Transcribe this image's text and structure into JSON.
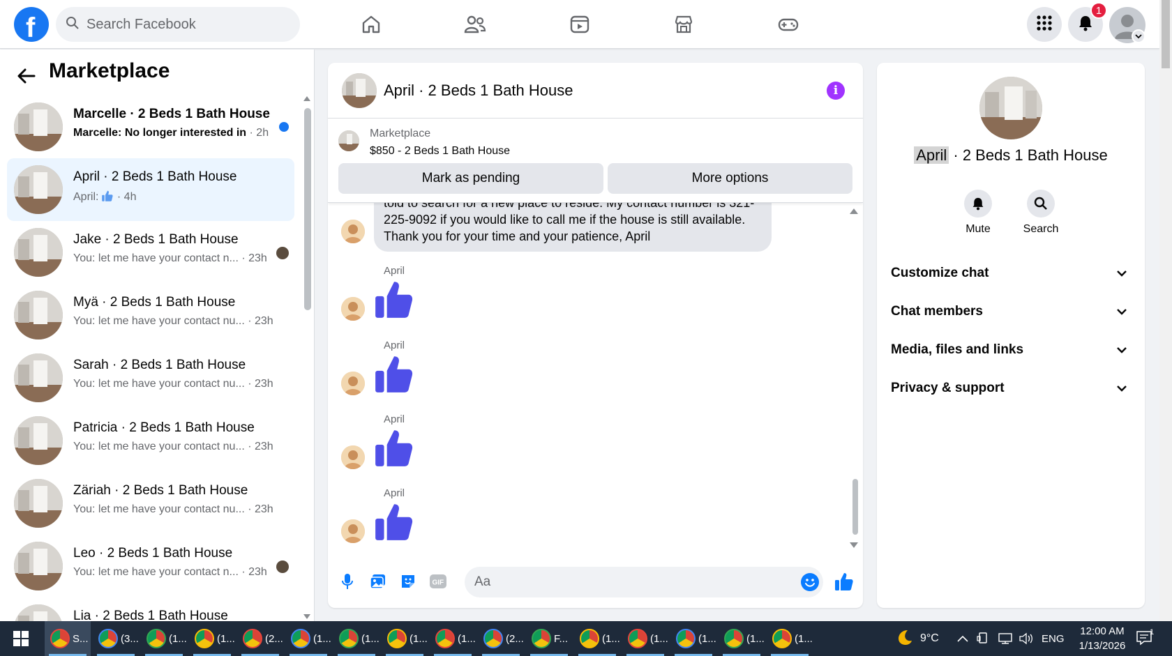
{
  "topbar": {
    "search_placeholder": "Search Facebook",
    "notification_count": "1",
    "nav_icons": [
      "home-icon",
      "friends-icon",
      "watch-icon",
      "marketplace-icon",
      "gaming-icon"
    ]
  },
  "left": {
    "title": "Marketplace",
    "conversations": [
      {
        "name": "Marcelle · 2 Beds 1 Bath House",
        "preview": "Marcelle: No longer interested in",
        "time": "· 2h",
        "unread": true
      },
      {
        "name": "April · 2 Beds 1 Bath House",
        "preview": "April:",
        "time": "· 4h",
        "selected": true
      },
      {
        "name": "Jake · 2 Beds 1 Bath House",
        "preview": "You: let me have your contact n...",
        "time": "· 23h"
      },
      {
        "name": "Myä · 2 Beds 1 Bath House",
        "preview": "You: let me have your contact nu...",
        "time": "· 23h"
      },
      {
        "name": "Sarah · 2 Beds 1 Bath House",
        "preview": "You: let me have your contact nu...",
        "time": "· 23h"
      },
      {
        "name": "Patricia · 2 Beds 1 Bath House",
        "preview": "You: let me have your contact nu...",
        "time": "· 23h"
      },
      {
        "name": "Zäriah · 2 Beds 1 Bath House",
        "preview": "You: let me have your contact nu...",
        "time": "· 23h"
      },
      {
        "name": "Leo · 2 Beds 1 Bath House",
        "preview": "You: let me have your contact n...",
        "time": "· 23h"
      },
      {
        "name": "Lia · 2 Beds 1 Bath House",
        "preview": "",
        "time": ""
      }
    ]
  },
  "chat": {
    "title": "April · 2 Beds 1 Bath House",
    "listing_source": "Marketplace",
    "listing_price": "$850 - 2 Beds 1 Bath House",
    "mark_pending_label": "Mark as pending",
    "more_options_label": "More options",
    "message_text": "told to search for a new place to reside. My contact number is 321-225-9092 if you would like to call me if the house is still available. Thank you for your time and your patience, April",
    "sender_name": "April",
    "composer_placeholder": "Aa",
    "accent": "#0a7cff",
    "like_color": "#4f4fe8"
  },
  "right": {
    "title_highlight": "April",
    "title_rest": " · 2 Beds 1 Bath House",
    "actions": [
      {
        "label": "Mute",
        "icon": "bell-icon"
      },
      {
        "label": "Search",
        "icon": "search-icon"
      }
    ],
    "sections": [
      "Customize chat",
      "Chat members",
      "Media, files and links",
      "Privacy & support"
    ]
  },
  "taskbar": {
    "items": [
      "S...",
      "(3...",
      "(1...",
      "(1...",
      "(2...",
      "(1...",
      "(1...",
      "(1...",
      "(1...",
      "(2...",
      "F...",
      "(1...",
      "(1...",
      "(1...",
      "(1...",
      "(1..."
    ],
    "weather": "9°C",
    "language": "ENG",
    "time": "12:00 AM",
    "date": "1/13/2026",
    "notification_count": "1"
  }
}
